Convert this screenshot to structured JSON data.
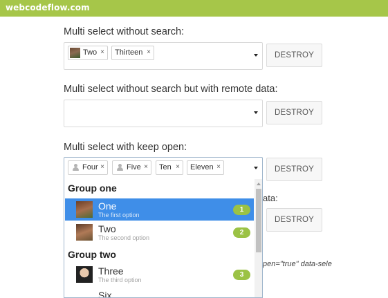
{
  "brand": "webcodeflow.com",
  "destroy_label": "DESTROY",
  "sections": [
    {
      "label": "Multi select without search:",
      "tags": [
        "Two",
        "Thirteen"
      ]
    },
    {
      "label": "Multi select without search but with remote data:",
      "tags": []
    },
    {
      "label": "Multi select with keep open:",
      "tags": [
        "Four",
        "Five",
        "Ten",
        "Eleven"
      ]
    }
  ],
  "tag_remove_glyph": "×",
  "partial_label_tail": "ata:",
  "code_fragment": "pen=\"true\" data-sele",
  "dropdown": {
    "groups": [
      {
        "label": "Group one",
        "options": [
          {
            "name": "One",
            "description": "The first option",
            "badge": "1",
            "highlighted": true
          },
          {
            "name": "Two",
            "description": "The second option",
            "badge": "2",
            "highlighted": false
          }
        ]
      },
      {
        "label": "Group two",
        "options": [
          {
            "name": "Three",
            "description": "The third option",
            "badge": "3",
            "highlighted": false
          },
          {
            "name": "Six",
            "description": "",
            "badge": "",
            "highlighted": false
          }
        ]
      }
    ]
  },
  "colors": {
    "topbar": "#a6c649",
    "highlight": "#3f8ee8",
    "badge": "#9bc245"
  },
  "icons": {
    "user": "user-icon",
    "caret": "chevron-down-icon",
    "scroll_up": "scroll-up-arrow-icon"
  }
}
